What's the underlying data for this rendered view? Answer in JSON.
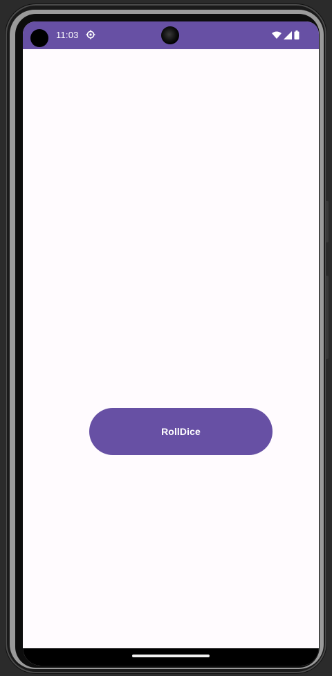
{
  "status_bar": {
    "time": "11:03",
    "icons": [
      "gear-icon",
      "wifi-icon",
      "signal-icon",
      "battery-icon"
    ],
    "background_color": "#6750a4"
  },
  "main": {
    "roll_button_label": "RollDice",
    "button_color": "#6750a4",
    "background_color": "#fffbfe"
  }
}
